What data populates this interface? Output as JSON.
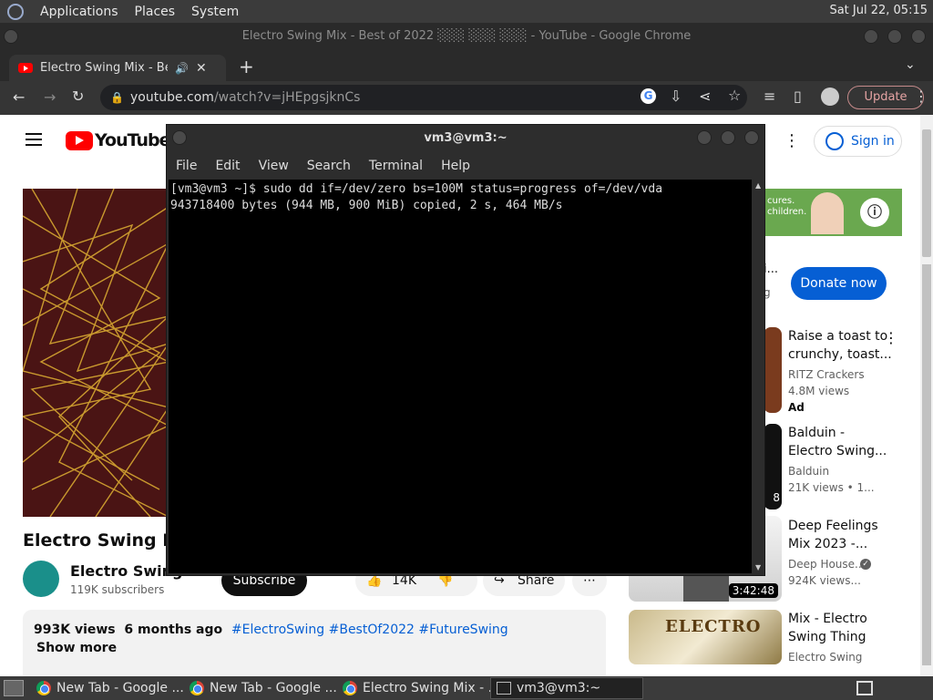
{
  "panel": {
    "menu": [
      "Applications",
      "Places",
      "System"
    ],
    "clock": "Sat Jul 22, 05:15"
  },
  "chrome": {
    "window_title": "Electro Swing Mix - Best of 2022 ░░░ ░░░ ░░░ - YouTube - Google Chrome",
    "tab_title": "Electro Swing Mix - Best o",
    "url_host": "youtube.com",
    "url_path": "/watch?v=jHEpgsjknCs",
    "update_label": "Update"
  },
  "youtube": {
    "logo_text": "YouTube",
    "signin_label": "Sign in",
    "ad_text_1": "cures.",
    "ad_text_2": "children.",
    "donate_label": "Donate now",
    "video_title": "Electro Swing Mix",
    "channel_name": "Electro Swing T",
    "subscribers": "119K subscribers",
    "subscribe_label": "Subscribe",
    "likes": "14K",
    "share_label": "Share",
    "views": "993K views",
    "age": "6 months ago",
    "tags": "#ElectroSwing #BestOf2022 #FutureSwing",
    "show_more": "Show more",
    "sidebar": [
      {
        "title1": "Raise a toast to",
        "title2": "crunchy, toast...",
        "channel": "RITZ Crackers",
        "views": "4.8M views",
        "badge": "Ad"
      },
      {
        "title1": "Balduin -",
        "title2": "Electro Swing...",
        "channel": "Balduin",
        "views": "21K views • 1...",
        "duration": "8"
      },
      {
        "title1": "Deep Feelings",
        "title2": "Mix 2023 -...",
        "channel": "Deep House...",
        "views": "924K views...",
        "duration": "3:42:48"
      },
      {
        "title1": "Mix - Electro",
        "title2": "Swing Thing",
        "channel": "Electro Swing"
      }
    ],
    "partial_i": "i...",
    "partial_g": "g"
  },
  "terminal": {
    "title": "vm3@vm3:~",
    "menu": [
      "File",
      "Edit",
      "View",
      "Search",
      "Terminal",
      "Help"
    ],
    "line1": "[vm3@vm3 ~]$ sudo dd if=/dev/zero bs=100M status=progress of=/dev/vda",
    "line2": "943718400 bytes (944 MB, 900 MiB) copied, 2 s, 464 MB/s"
  },
  "taskbar": {
    "tasks": [
      "New Tab - Google ...",
      "New Tab - Google ...",
      "Electro Swing Mix - ...",
      "vm3@vm3:~"
    ]
  },
  "colors": {
    "accent": "#065fd4",
    "yt_red": "#ff0000"
  }
}
